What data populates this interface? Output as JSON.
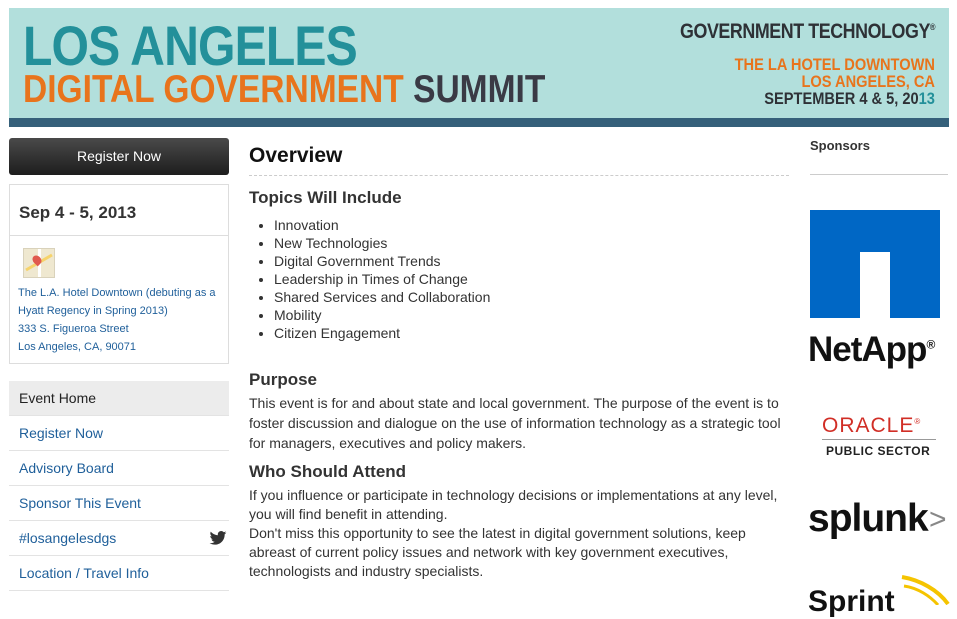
{
  "banner": {
    "title_line1": "LOS ANGELES",
    "title_line2a": "DIGITAL GOVERNMENT",
    "title_line2b": "SUMMIT",
    "publisher": "GOVERNMENT TECHNOLOGY",
    "publisher_mark": "®",
    "venue_line1": "THE LA HOTEL DOWNTOWN",
    "venue_line2": "LOS ANGELES, CA",
    "date_line_main": "SEPTEMBER 4 & 5, 20",
    "date_line_year": "13"
  },
  "sidebar": {
    "register_label": "Register Now",
    "event_date": "Sep 4 - 5, 2013",
    "address_line1": "The L.A. Hotel Downtown (debuting as a Hyatt Regency in Spring 2013)",
    "address_line2": "333 S. Figueroa Street",
    "address_line3": "Los Angeles, CA, 90071",
    "nav": [
      {
        "label": "Event Home"
      },
      {
        "label": "Register Now"
      },
      {
        "label": "Advisory Board"
      },
      {
        "label": "Sponsor This Event"
      },
      {
        "label": "#losangelesdgs"
      },
      {
        "label": "Location / Travel Info"
      }
    ]
  },
  "main": {
    "overview_title": "Overview",
    "topics_title": "Topics Will Include",
    "topics": [
      "Innovation",
      "New Technologies",
      "Digital Government Trends",
      "Leadership in Times of Change",
      "Shared Services and Collaboration",
      "Mobility",
      "Citizen Engagement"
    ],
    "purpose_title": "Purpose",
    "purpose_text": "This event is for and about state and local government. The purpose of the event is to foster discussion and dialogue on the use of information technology as a strategic tool for managers, executives and policy makers.",
    "attend_title": "Who Should Attend",
    "attend_text1": "If you influence or participate in technology decisions or implementations at any level, you will find benefit in attending.",
    "attend_text2": "Don't miss this opportunity to see the latest in digital government solutions, keep abreast of current policy issues and network with key government executives, technologists and industry specialists."
  },
  "sponsors": {
    "title": "Sponsors",
    "netapp": "NetApp",
    "netapp_mark": "®",
    "oracle": "ORACLE",
    "oracle_mark": "®",
    "oracle_sub": "PUBLIC SECTOR",
    "splunk": "splunk",
    "splunk_mark": ">",
    "sprint": "Sprint"
  },
  "colors": {
    "banner_bg": "#b2dfdc",
    "banner_bar": "#35607a",
    "teal": "#23909a",
    "orange": "#e8741c",
    "link": "#1f5f9a",
    "netapp_blue": "#0067c5",
    "oracle_red": "#d12e26"
  }
}
